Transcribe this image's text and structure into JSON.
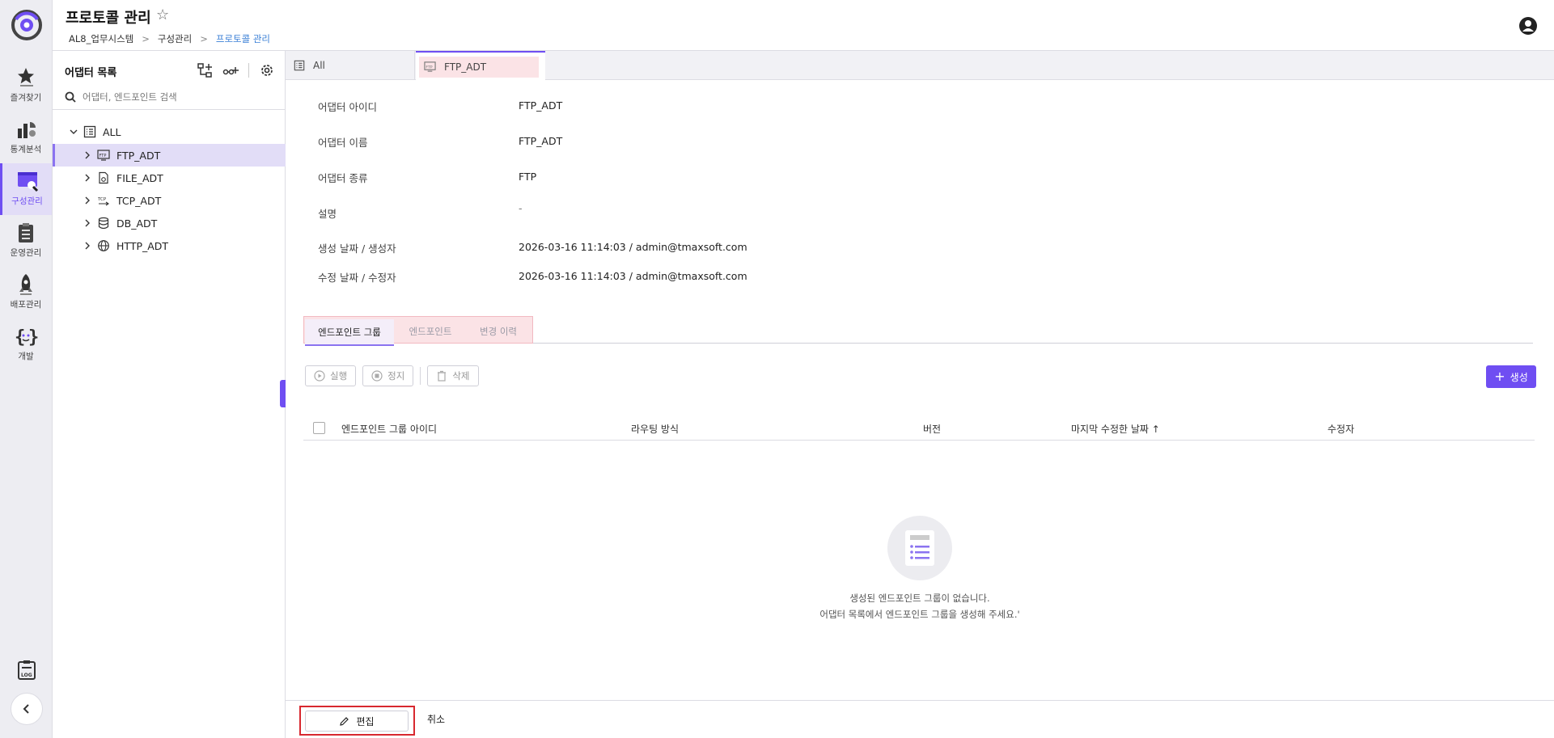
{
  "header": {
    "title": "프로토콜 관리",
    "breadcrumbs": [
      "AL8_업무시스템",
      "구성관리",
      "프로토콜 관리"
    ]
  },
  "rail": {
    "items": [
      {
        "label": "즐겨찾기",
        "icon": "star-icon"
      },
      {
        "label": "통계분석",
        "icon": "chart-icon"
      },
      {
        "label": "구성관리",
        "icon": "config-icon"
      },
      {
        "label": "운영관리",
        "icon": "clipboard-icon"
      },
      {
        "label": "배포관리",
        "icon": "rocket-icon"
      },
      {
        "label": "개발",
        "icon": "code-icon"
      }
    ],
    "log_icon_text": "LOG"
  },
  "tree": {
    "title": "어댑터 목록",
    "search_placeholder": "어댑터, 엔드포인트 검색",
    "root": "ALL",
    "nodes": [
      "FTP_ADT",
      "FILE_ADT",
      "TCP_ADT",
      "DB_ADT",
      "HTTP_ADT"
    ]
  },
  "tabs": {
    "all": "All",
    "ftp": "FTP_ADT"
  },
  "info": {
    "adapter_id_label": "어댑터 아이디",
    "adapter_id_value": "FTP_ADT",
    "adapter_name_label": "어댑터 이름",
    "adapter_name_value": "FTP_ADT",
    "adapter_type_label": "어댑터 종류",
    "adapter_type_value": "FTP",
    "description_label": "설명",
    "description_value": "-",
    "created_label": "생성 날짜 / 생성자",
    "created_value": "2026-03-16 11:14:03 / admin@tmaxsoft.com",
    "modified_label": "수정 날짜 / 수정자",
    "modified_value": "2026-03-16 11:14:03 / admin@tmaxsoft.com"
  },
  "subtabs": [
    "엔드포인트 그룹",
    "엔드포인트",
    "변경 이력"
  ],
  "actions": {
    "run": "실행",
    "stop": "정지",
    "delete": "삭제",
    "create": "생성"
  },
  "table": {
    "columns": [
      "엔드포인트 그룹 아이디",
      "라우팅 방식",
      "버전",
      "마지막 수정한 날짜 ↑",
      "수정자"
    ]
  },
  "empty": {
    "line1": "생성된 엔드포인트 그룹이 없습니다.",
    "line2": "어댑터 목록에서 엔드포인트 그룹을 생성해 주세요.'"
  },
  "footer": {
    "edit": "편집",
    "cancel": "취소"
  },
  "colors": {
    "accent": "#6f4ef2",
    "highlight": "#fbe3e6",
    "edit_border": "#d8282f"
  }
}
